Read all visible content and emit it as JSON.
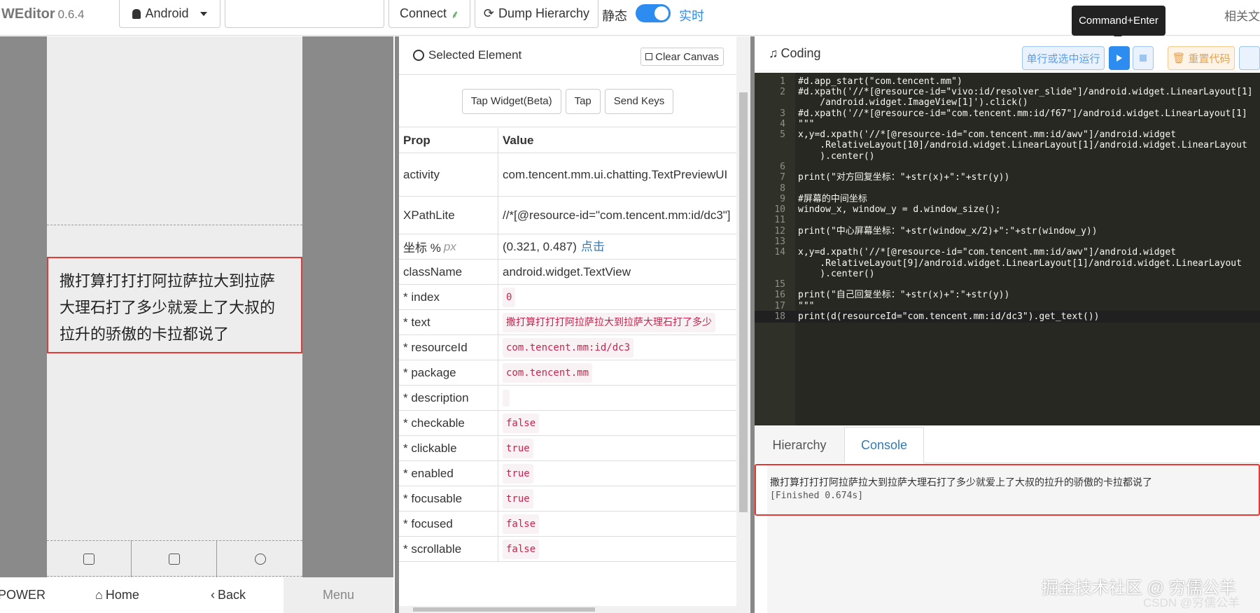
{
  "topbar": {
    "brand": "WEditor",
    "version": "0.6.4",
    "platform": "Android",
    "device_input_value": "",
    "connect_label": "Connect",
    "dump_label": "Dump Hierarchy",
    "static_label": "静态",
    "realtime_label": "实时",
    "realtime_enabled": true,
    "tooltip": "Command+Enter",
    "related_docs": "相关文"
  },
  "device": {
    "message_text": "撒打算打打打阿拉萨拉大到拉萨大理石打了多少就爱上了大叔的拉升的骄傲的卡拉都说了",
    "nav": {
      "power": "POWER",
      "home": "Home",
      "back": "Back",
      "menu": "Menu"
    }
  },
  "props_panel": {
    "title": "Selected Element",
    "clear_canvas": "Clear Canvas",
    "actions": [
      "Tap Widget(Beta)",
      "Tap",
      "Send Keys"
    ],
    "columns": [
      "Prop",
      "Value"
    ],
    "rows": [
      {
        "key": "activity",
        "value": "com.tencent.mm.ui.chatting.TextPreviewUI",
        "type": "text"
      },
      {
        "key": "XPathLite",
        "value": "//*[@resource-id=\"com.tencent.mm:id/dc3\"]",
        "type": "text"
      },
      {
        "key": "坐标 %",
        "unit": "px",
        "value": "(0.321, 0.487)",
        "link": "点击",
        "type": "coord"
      },
      {
        "key": "className",
        "value": "android.widget.TextView",
        "type": "text"
      },
      {
        "key": "* index",
        "value": "0",
        "type": "code"
      },
      {
        "key": "* text",
        "value": "撒打算打打打阿拉萨拉大到拉萨大理石打了多少",
        "type": "code"
      },
      {
        "key": "* resourceId",
        "value": "com.tencent.mm:id/dc3",
        "type": "code"
      },
      {
        "key": "* package",
        "value": "com.tencent.mm",
        "type": "code"
      },
      {
        "key": "* description",
        "value": "",
        "type": "code"
      },
      {
        "key": "* checkable",
        "value": "false",
        "type": "code"
      },
      {
        "key": "* clickable",
        "value": "true",
        "type": "code"
      },
      {
        "key": "* enabled",
        "value": "true",
        "type": "code"
      },
      {
        "key": "* focusable",
        "value": "true",
        "type": "code"
      },
      {
        "key": "* focused",
        "value": "false",
        "type": "code"
      },
      {
        "key": "* scrollable",
        "value": "false",
        "type": "code"
      }
    ]
  },
  "coding_panel": {
    "title": "Coding",
    "run_selected": "单行或选中运行",
    "reset_code": "重置代码",
    "code_lines": [
      {
        "n": "1",
        "text": "#d.app_start(\"com.tencent.mm\")",
        "style": "cmt"
      },
      {
        "n": "2",
        "text": "#d.xpath('//*[@resource-id=\"vivo:id/resolver_slide\"]/android.widget.LinearLayout[1]",
        "style": "cmt"
      },
      {
        "n": "",
        "text": "    /android.widget.ImageView[1]').click()",
        "style": "cmt"
      },
      {
        "n": "3",
        "text": "#d.xpath('//*[@resource-id=\"com.tencent.mm:id/f67\"]/android.widget.LinearLayout[1]",
        "style": "cmt"
      },
      {
        "n": "4",
        "text": "\"\"\"",
        "style": "yel"
      },
      {
        "n": "5",
        "text": "x,y=d.xpath('//*[@resource-id=\"com.tencent.mm:id/awv\"]/android.widget",
        "style": "yel"
      },
      {
        "n": "",
        "text": "    .RelativeLayout[10]/android.widget.LinearLayout[1]/android.widget.LinearLayout",
        "style": "yel"
      },
      {
        "n": "",
        "text": "    ).center()",
        "style": "yel"
      },
      {
        "n": "6",
        "text": "",
        "style": "yel"
      },
      {
        "n": "7",
        "text": "print(\"对方回复坐标：\"+str(x)+\":\"+str(y))",
        "style": "yel"
      },
      {
        "n": "8",
        "text": "",
        "style": "yel"
      },
      {
        "n": "9",
        "text": "#屏幕的中间坐标",
        "style": "yel"
      },
      {
        "n": "10",
        "text": "window_x, window_y = d.window_size();",
        "style": "yel"
      },
      {
        "n": "11",
        "text": "",
        "style": "yel"
      },
      {
        "n": "12",
        "text": "print(\"中心屏幕坐标：\"+str(window_x/2)+\":\"+str(window_y))",
        "style": "yel"
      },
      {
        "n": "13",
        "text": "",
        "style": "yel"
      },
      {
        "n": "14",
        "text": "x,y=d.xpath('//*[@resource-id=\"com.tencent.mm:id/awv\"]/android.widget",
        "style": "yel"
      },
      {
        "n": "",
        "text": "    .RelativeLayout[9]/android.widget.LinearLayout[1]/android.widget.LinearLayout",
        "style": "yel"
      },
      {
        "n": "",
        "text": "    ).center()",
        "style": "yel"
      },
      {
        "n": "15",
        "text": "",
        "style": "yel"
      },
      {
        "n": "16",
        "text": "print(\"自己回复坐标：\"+str(x)+\":\"+str(y))",
        "style": "yel"
      },
      {
        "n": "17",
        "text": "\"\"\"",
        "style": "yel"
      },
      {
        "n": "18",
        "text": "print(d(resourceId=\"com.tencent.mm:id/dc3\").get_text())",
        "style": "active"
      }
    ],
    "tabs": [
      "Hierarchy",
      "Console"
    ],
    "active_tab": "Console",
    "console_output": "撒打算打打打阿拉萨拉大到拉萨大理石打了多少就爱上了大叔的拉升的骄傲的卡拉都说了",
    "console_finished": "[Finished 0.674s]"
  },
  "watermark": "掘金技术社区 @ 穷儒公羊",
  "watermark_small": "CSDN @穷儒公羊"
}
